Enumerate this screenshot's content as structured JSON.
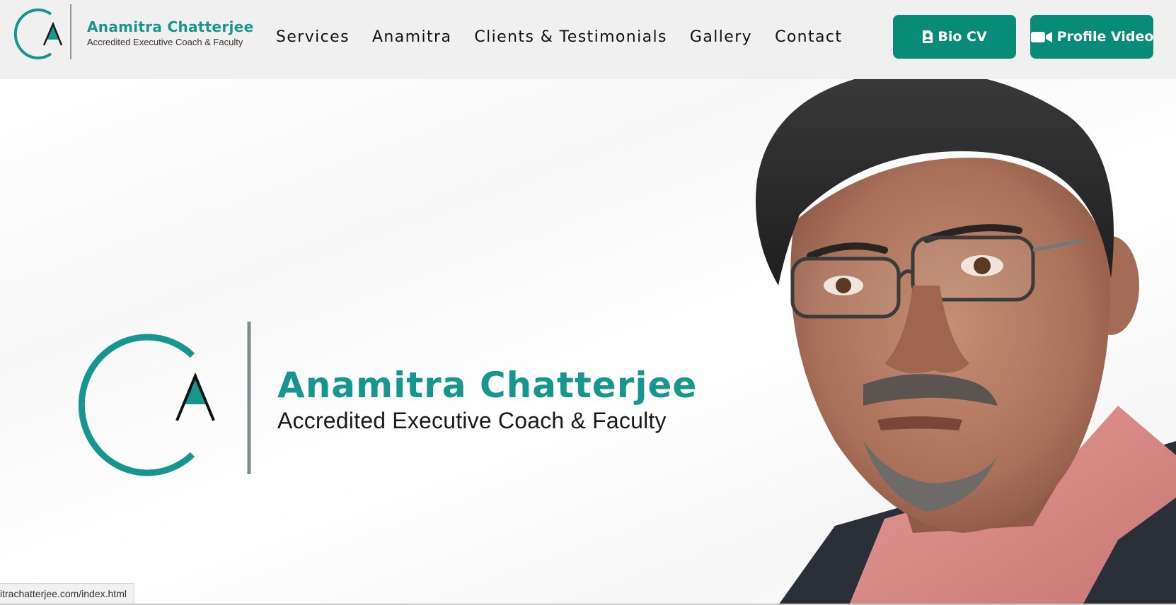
{
  "navbar": {
    "brand": {
      "name": "Anamitra Chatterjee",
      "tagline": "Accredited Executive Coach & Faculty",
      "logo_icon": "ca-monogram-logo"
    },
    "links": [
      {
        "label": "Services"
      },
      {
        "label": "Anamitra"
      },
      {
        "label": "Clients & Testimonials"
      },
      {
        "label": "Gallery"
      },
      {
        "label": "Contact"
      }
    ],
    "buttons": {
      "bio_cv": {
        "label": "Bio CV",
        "icon": "document-user-icon"
      },
      "profile_video": {
        "label": "Profile Video",
        "icon": "video-camera-icon"
      }
    }
  },
  "hero": {
    "name": "Anamitra Chatterjee",
    "tagline": "Accredited Executive Coach & Faculty",
    "portrait": "portrait-photo"
  },
  "status_bar": {
    "url": "itrachatterjee.com/index.html"
  },
  "colors": {
    "brand_teal": "#16968f",
    "button_green": "#088b79",
    "navbar_bg": "#f0f0f1",
    "text_dark": "#111111"
  }
}
